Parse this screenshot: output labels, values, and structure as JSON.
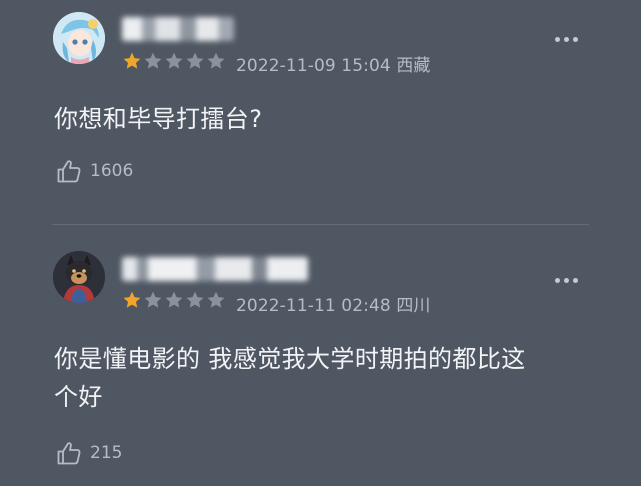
{
  "comments": [
    {
      "rating": 1,
      "time": "2022-11-09 15:04",
      "region": "西藏",
      "text": "你想和毕导打擂台?",
      "likes": "1606"
    },
    {
      "rating": 1,
      "time": "2022-11-11 02:48",
      "region": "四川",
      "text": "你是懂电影的 我感觉我大学时期拍的都比这\n个好",
      "likes": "215"
    }
  ],
  "colors": {
    "background": "#4f5763",
    "text": "#f2f3f5",
    "meta": "#b7bcc4",
    "star_on": "#f1a62b",
    "star_off": "#8c929c"
  }
}
